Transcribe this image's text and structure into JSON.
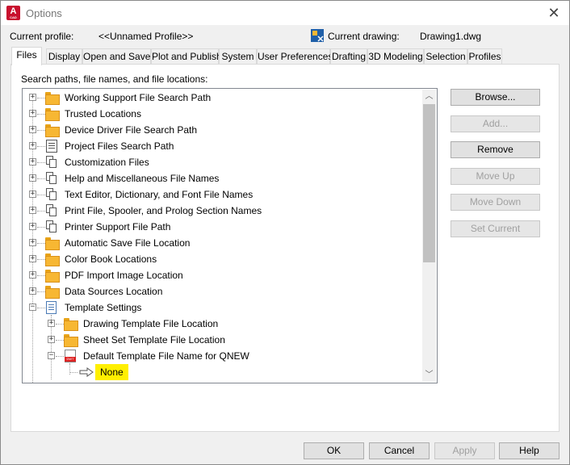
{
  "window": {
    "title": "Options",
    "app_icon": "A",
    "app_icon_sub": "CAD"
  },
  "profile": {
    "label": "Current profile:",
    "value": "<<Unnamed Profile>>",
    "drawing_label": "Current drawing:",
    "drawing_value": "Drawing1.dwg"
  },
  "tabs": [
    "Files",
    "Display",
    "Open and Save",
    "Plot and Publish",
    "System",
    "User Preferences",
    "Drafting",
    "3D Modeling",
    "Selection",
    "Profiles"
  ],
  "files": {
    "heading": "Search paths, file names, and file locations:",
    "tree": [
      {
        "label": "Working Support File Search Path",
        "icon": "folder-icon",
        "expander": "+"
      },
      {
        "label": "Trusted Locations",
        "icon": "folder-icon",
        "expander": "+"
      },
      {
        "label": "Device Driver File Search Path",
        "icon": "folder-icon",
        "expander": "+"
      },
      {
        "label": "Project Files Search Path",
        "icon": "project-icon",
        "expander": "+"
      },
      {
        "label": "Customization Files",
        "icon": "pages-icon",
        "expander": "+"
      },
      {
        "label": "Help and Miscellaneous File Names",
        "icon": "pages-icon",
        "expander": "+"
      },
      {
        "label": "Text Editor, Dictionary, and Font File Names",
        "icon": "pages-icon",
        "expander": "+"
      },
      {
        "label": "Print File, Spooler, and Prolog Section Names",
        "icon": "pages-icon",
        "expander": "+"
      },
      {
        "label": "Printer Support File Path",
        "icon": "pages-icon",
        "expander": "+"
      },
      {
        "label": "Automatic Save File Location",
        "icon": "folder-icon",
        "expander": "+"
      },
      {
        "label": "Color Book Locations",
        "icon": "folder-icon",
        "expander": "+"
      },
      {
        "label": "PDF Import Image Location",
        "icon": "folder-icon",
        "expander": "+"
      },
      {
        "label": "Data Sources Location",
        "icon": "folder-icon",
        "expander": "+"
      },
      {
        "label": "Template Settings",
        "icon": "template-icon",
        "expander": "−"
      },
      {
        "label": "Drawing Template File Location",
        "icon": "folder-icon",
        "expander": "+"
      },
      {
        "label": "Sheet Set Template File Location",
        "icon": "folder-icon",
        "expander": "+"
      },
      {
        "label": "Default Template File Name for QNEW",
        "icon": "dwt-icon",
        "expander": "−"
      },
      {
        "label": "None",
        "icon": "arrow-right-icon",
        "expander": ""
      }
    ]
  },
  "side_buttons": {
    "browse": "Browse...",
    "add": "Add...",
    "remove": "Remove",
    "move_up": "Move Up",
    "move_down": "Move Down",
    "set_current": "Set Current"
  },
  "footer": {
    "ok": "OK",
    "cancel": "Cancel",
    "apply": "Apply",
    "help": "Help"
  },
  "colors": {
    "highlight": "#ffef00",
    "folder": "#f7b733",
    "app_icon": "#c8102e"
  }
}
